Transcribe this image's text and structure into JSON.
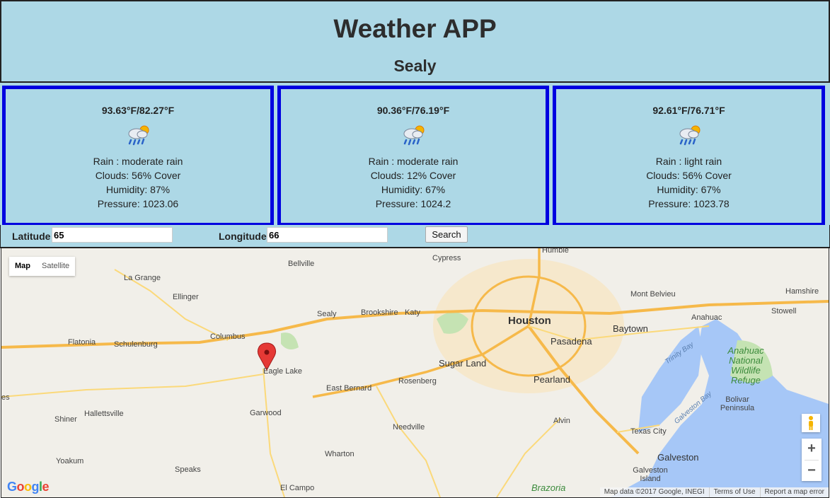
{
  "app": {
    "title": "Weather APP",
    "city": "Sealy"
  },
  "forecasts": [
    {
      "temp": "93.63°F/82.27°F",
      "icon": "rain-cloud-sun-icon",
      "rain": "Rain : moderate rain",
      "clouds": "Clouds: 56% Cover",
      "humidity": "Humidity: 87%",
      "pressure": "Pressure: 1023.06"
    },
    {
      "temp": "90.36°F/76.19°F",
      "icon": "rain-cloud-sun-icon",
      "rain": "Rain : moderate rain",
      "clouds": "Clouds: 12% Cover",
      "humidity": "Humidity: 67%",
      "pressure": "Pressure: 1024.2"
    },
    {
      "temp": "92.61°F/76.71°F",
      "icon": "rain-cloud-sun-icon",
      "rain": "Rain : light rain",
      "clouds": "Clouds: 56% Cover",
      "humidity": "Humidity: 67%",
      "pressure": "Pressure: 1023.78"
    }
  ],
  "form": {
    "latitude_label": "Latitude",
    "latitude_value": "65",
    "longitude_label": "Longitude",
    "longitude_value": "66",
    "search_label": "Search"
  },
  "map": {
    "type_map": "Map",
    "type_satellite": "Satellite",
    "zoom_in": "+",
    "zoom_out": "−",
    "google_logo": "Google",
    "attribution": {
      "data": "Map data ©2017 Google, INEGI",
      "terms": "Terms of Use",
      "report": "Report a map error"
    },
    "labels": {
      "humble": "Humble",
      "cypress": "Cypress",
      "bellville": "Bellville",
      "la_grange": "La Grange",
      "ellinger": "Ellinger",
      "sealy": "Sealy",
      "brookshire": "Brookshire",
      "katy": "Katy",
      "houston": "Houston",
      "pasadena": "Pasadena",
      "baytown": "Baytown",
      "mont_belvieu": "Mont Belvieu",
      "hamshire": "Hamshire",
      "stowell": "Stowell",
      "anahuac": "Anahuac",
      "columbus": "Columbus",
      "flatonia": "Flatonia",
      "schulenburg": "Schulenburg",
      "eagle_lake": "Eagle Lake",
      "sugar_land": "Sugar Land",
      "east_bernard": "East Bernard",
      "rosenberg": "Rosenberg",
      "pearland": "Pearland",
      "trinity_bay": "Trinity Bay",
      "anahuac_refuge": "Anahuac National Wildlife Refuge",
      "bolivar": "Bolivar Peninsula",
      "galveston_bay": "Galveston Bay",
      "hallettsville": "Hallettsville",
      "garwood": "Garwood",
      "shiner": "Shiner",
      "needville": "Needville",
      "alvin": "Alvin",
      "texas_city": "Texas City",
      "galveston": "Galveston",
      "galveston_island": "Galveston Island",
      "wharton": "Wharton",
      "yoakum": "Yoakum",
      "speaks": "Speaks",
      "el_campo": "El Campo",
      "brazoria": "Brazoria",
      "es": "es"
    }
  },
  "colors": {
    "header_bg": "#add8e6",
    "card_border": "#0000e0",
    "marker": "#e53935"
  }
}
